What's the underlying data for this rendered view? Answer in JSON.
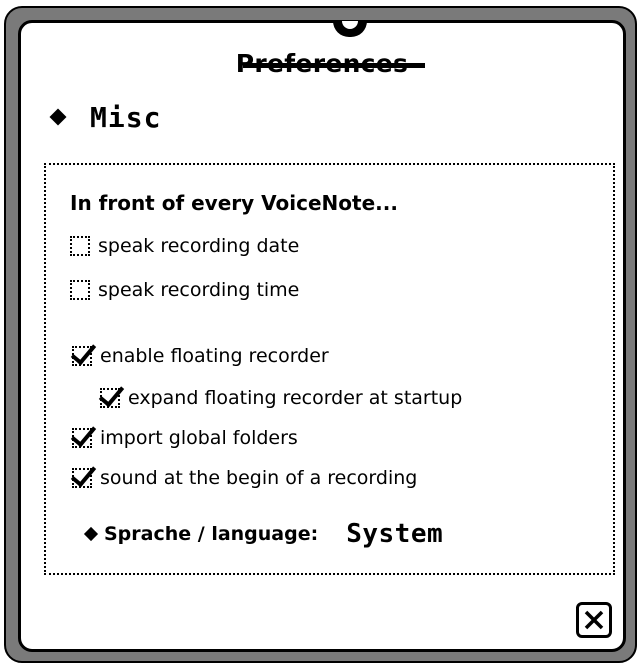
{
  "window": {
    "title": "Preferences"
  },
  "section": {
    "label": "Misc"
  },
  "panel": {
    "heading": "In front of every VoiceNote...",
    "options": [
      {
        "label": "speak recording date",
        "checked": false
      },
      {
        "label": "speak recording time",
        "checked": false
      },
      {
        "label": "enable floating recorder",
        "checked": true
      },
      {
        "label": "expand floating recorder at startup",
        "checked": true
      },
      {
        "label": "import global folders",
        "checked": true
      },
      {
        "label": "sound at the begin of a recording",
        "checked": true
      }
    ],
    "language": {
      "label": "Sprache / language:",
      "value": "System"
    }
  },
  "icons": {
    "section_bullet": "diamond-icon",
    "language_bullet": "diamond-icon",
    "close": "close-icon"
  }
}
